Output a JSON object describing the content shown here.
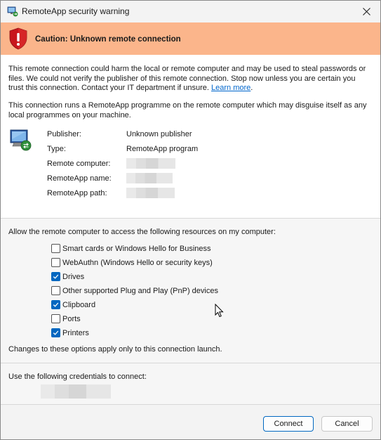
{
  "window": {
    "title": "RemoteApp security warning"
  },
  "banner": {
    "text": "Caution: Unknown remote connection",
    "color": "#fbb58b"
  },
  "intro": {
    "warning_text": "This remote connection could harm the local or remote computer and may be used to steal passwords or files. We could not verify the publisher of this remote connection. Stop now unless you are certain you trust this connection. Contact your IT department if unsure.",
    "learn_more_label": "Learn more",
    "trailing_period": ".",
    "disguise_text": "This connection runs a RemoteApp programme on the remote computer which may disguise itself as any local programmes on your machine."
  },
  "details": {
    "publisher_label": "Publisher:",
    "publisher_value": "Unknown publisher",
    "type_label": "Type:",
    "type_value": "RemoteApp program",
    "remote_computer_label": "Remote computer:",
    "remoteapp_name_label": "RemoteApp name:",
    "remoteapp_path_label": "RemoteApp path:"
  },
  "resources": {
    "heading": "Allow the remote computer to access the following resources on my computer:",
    "items": [
      {
        "label": "Smart cards or Windows Hello for Business",
        "checked": false
      },
      {
        "label": "WebAuthn (Windows Hello or security keys)",
        "checked": false
      },
      {
        "label": "Drives",
        "checked": true
      },
      {
        "label": "Other supported Plug and Play (PnP) devices",
        "checked": false
      },
      {
        "label": "Clipboard",
        "checked": true
      },
      {
        "label": "Ports",
        "checked": false
      },
      {
        "label": "Printers",
        "checked": true
      }
    ],
    "note": "Changes to these options apply only to this connection launch."
  },
  "credentials": {
    "heading": "Use the following credentials to connect:"
  },
  "footer": {
    "connect_label": "Connect",
    "cancel_label": "Cancel",
    "accent": "#0067c0"
  },
  "icons": [
    "remote-desktop-app-icon",
    "close-icon",
    "warning-shield-icon",
    "remote-computer-icon",
    "checkmark-icon",
    "mouse-cursor-icon"
  ]
}
